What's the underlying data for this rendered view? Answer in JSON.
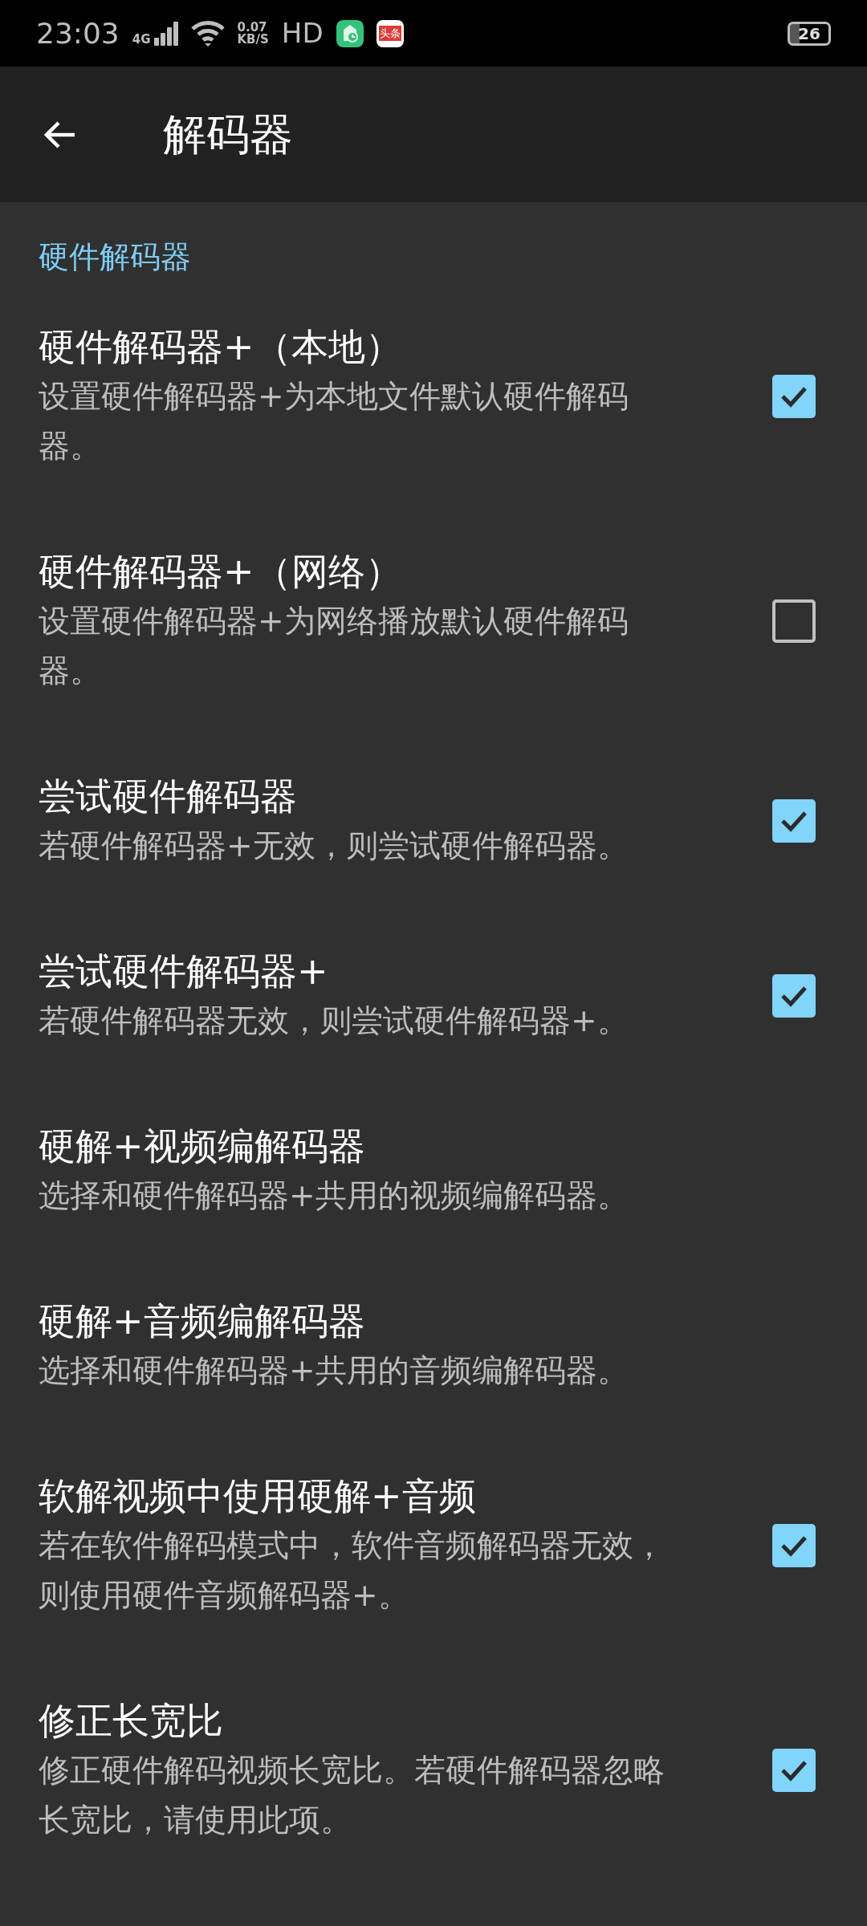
{
  "status_bar": {
    "time": "23:03",
    "network": "4G",
    "speed_value": "0.07",
    "speed_unit": "KB/S",
    "hd": "HD",
    "news_app_label": "头条",
    "battery": "26"
  },
  "app_bar": {
    "title": "解码器"
  },
  "category": "硬件解码器",
  "items": [
    {
      "kind": "checkbox",
      "title": "硬件解码器+（本地）",
      "summary": "设置硬件解码器+为本地文件默认硬件解码器。",
      "checked": true
    },
    {
      "kind": "checkbox",
      "title": "硬件解码器+（网络）",
      "summary": "设置硬件解码器+为网络播放默认硬件解码器。",
      "checked": false
    },
    {
      "kind": "checkbox",
      "title": "尝试硬件解码器",
      "summary": "若硬件解码器+无效，则尝试硬件解码器。",
      "checked": true
    },
    {
      "kind": "checkbox",
      "title": "尝试硬件解码器+",
      "summary": "若硬件解码器无效，则尝试硬件解码器+。",
      "checked": true
    },
    {
      "kind": "list",
      "title": "硬解+视频编解码器",
      "summary": "选择和硬件解码器+共用的视频编解码器。"
    },
    {
      "kind": "list",
      "title": "硬解+音频编解码器",
      "summary": "选择和硬件解码器+共用的音频编解码器。"
    },
    {
      "kind": "checkbox",
      "title": "软解视频中使用硬解+音频",
      "summary": "若在软件解码模式中，软件音频解码器无效，则使用硬件音频解码器+。",
      "checked": true
    },
    {
      "kind": "checkbox",
      "title": "修正长宽比",
      "summary": "修正硬件解码视频长宽比。若硬件解码器忽略长宽比，请使用此项。",
      "checked": true
    }
  ]
}
